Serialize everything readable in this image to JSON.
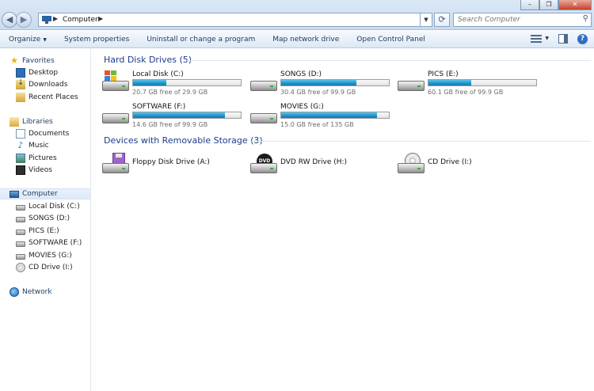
{
  "address": {
    "crumb": "Computer"
  },
  "search": {
    "placeholder": "Search Computer"
  },
  "toolbar": {
    "organize": "Organize",
    "system_properties": "System properties",
    "uninstall": "Uninstall or change a program",
    "map_drive": "Map network drive",
    "control_panel": "Open Control Panel"
  },
  "nav": {
    "favorites": "Favorites",
    "desktop": "Desktop",
    "downloads": "Downloads",
    "recent": "Recent Places",
    "libraries": "Libraries",
    "documents": "Documents",
    "music": "Music",
    "pictures": "Pictures",
    "videos": "Videos",
    "computer": "Computer",
    "drives": [
      "Local Disk (C:)",
      "SONGS (D:)",
      "PICS (E:)",
      "SOFTWARE (F:)",
      "MOVIES (G:)",
      "CD Drive (I:)"
    ],
    "network": "Network"
  },
  "groups": {
    "hdd_title": "Hard Disk Drives (5)",
    "removable_title": "Devices with Removable Storage (3)"
  },
  "hard_drives": [
    {
      "name": "Local Disk (C:)",
      "free": "20.7 GB free of 29.9 GB",
      "used_fraction": 0.31
    },
    {
      "name": "SONGS (D:)",
      "free": "30.4 GB free of 99.9 GB",
      "used_fraction": 0.7
    },
    {
      "name": "PICS (E:)",
      "free": "60.1 GB free of 99.9 GB",
      "used_fraction": 0.4
    },
    {
      "name": "SOFTWARE (F:)",
      "free": "14.6 GB free of 99.9 GB",
      "used_fraction": 0.85
    },
    {
      "name": "MOVIES (G:)",
      "free": "15.0 GB free of 135 GB",
      "used_fraction": 0.89
    }
  ],
  "removable": [
    {
      "name": "Floppy Disk Drive (A:)",
      "icon": "floppy-drive-icon"
    },
    {
      "name": "DVD RW Drive (H:)",
      "icon": "dvd-drive-icon",
      "badge": "DVD"
    },
    {
      "name": "CD Drive (I:)",
      "icon": "cd-drive-icon"
    }
  ],
  "colors": {
    "bar_fill": "#229bd1",
    "group_title": "#1e3a8a",
    "win_close": "#c7402b"
  }
}
